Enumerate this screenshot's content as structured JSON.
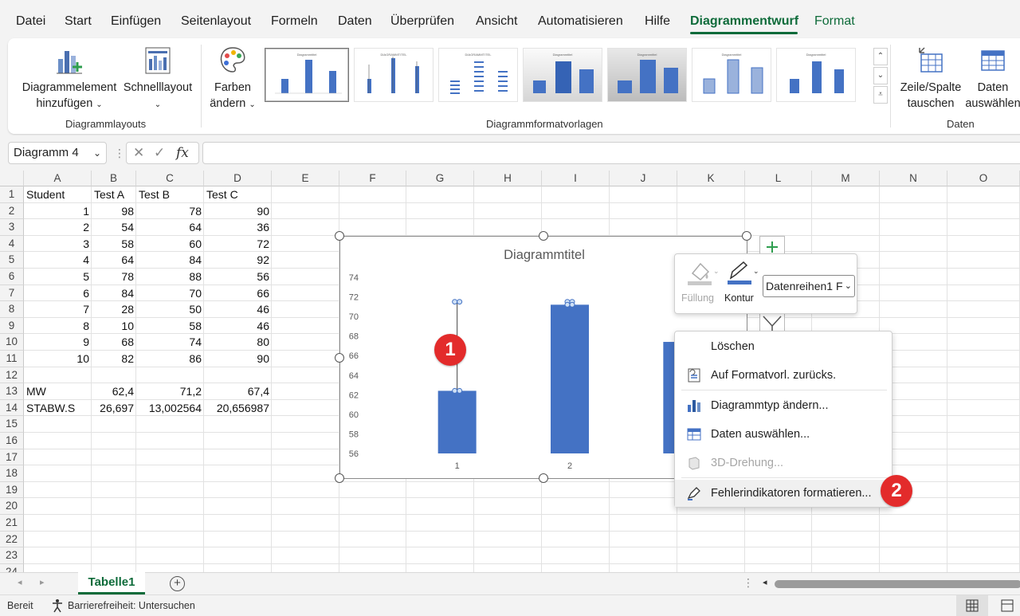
{
  "menu": {
    "tabs": [
      "Datei",
      "Start",
      "Einfügen",
      "Seitenlayout",
      "Formeln",
      "Daten",
      "Überprüfen",
      "Ansicht",
      "Automatisieren",
      "Hilfe",
      "Diagrammentwurf",
      "Format"
    ],
    "active": "Diagrammentwurf"
  },
  "ribbon": {
    "add_element": "Diagrammelement hinzufügen",
    "quick_layout": "Schnelllayout",
    "colors": "Farben ändern",
    "group_layouts": "Diagrammlayouts",
    "group_styles": "Diagrammformatvorlagen",
    "switch_row_col": "Zeile/Spalte tauschen",
    "select_data": "Daten auswählen",
    "group_data": "Daten",
    "thumb_titles": [
      "Diagrammtitel",
      "DIAGRAMMTITEL",
      "DIAGRAMMTITEL",
      "Diagrammtitel",
      "Diagrammtitel",
      "Diagrammtitel",
      "Diagrammtitel"
    ]
  },
  "formula_bar": {
    "name_box": "Diagramm 4",
    "fx": "fx"
  },
  "grid": {
    "columns": [
      "A",
      "B",
      "C",
      "D",
      "E",
      "F",
      "G",
      "H",
      "I",
      "J",
      "K",
      "L",
      "M",
      "N",
      "O"
    ],
    "rows": [
      "1",
      "2",
      "3",
      "4",
      "5",
      "6",
      "7",
      "8",
      "9",
      "10",
      "11",
      "12",
      "13",
      "14",
      "15",
      "16",
      "17",
      "18",
      "19",
      "20",
      "21",
      "22",
      "23",
      "24"
    ],
    "cells": [
      [
        "Student",
        "Test A",
        "Test B",
        "Test C"
      ],
      [
        "1",
        "98",
        "78",
        "90"
      ],
      [
        "2",
        "54",
        "64",
        "36"
      ],
      [
        "3",
        "58",
        "60",
        "72"
      ],
      [
        "4",
        "64",
        "84",
        "92"
      ],
      [
        "5",
        "78",
        "88",
        "56"
      ],
      [
        "6",
        "84",
        "70",
        "66"
      ],
      [
        "7",
        "28",
        "50",
        "46"
      ],
      [
        "8",
        "10",
        "58",
        "46"
      ],
      [
        "9",
        "68",
        "74",
        "80"
      ],
      [
        "10",
        "82",
        "86",
        "90"
      ],
      [
        "",
        "",
        "",
        ""
      ],
      [
        "MW",
        "62,4",
        "71,2",
        "67,4"
      ],
      [
        "STABW.S",
        "26,697",
        "13,002564",
        "20,656987"
      ]
    ]
  },
  "chart": {
    "title": "Diagrammtitel",
    "y_ticks": [
      "74",
      "72",
      "70",
      "68",
      "66",
      "64",
      "62",
      "60",
      "58",
      "56"
    ],
    "x_labels": [
      "1",
      "2",
      "3"
    ],
    "bar_color": "#4472c4"
  },
  "chart_data": {
    "type": "bar",
    "title": "Diagrammtitel",
    "categories": [
      "1",
      "2",
      "3"
    ],
    "values": [
      62.4,
      71.2,
      67.4
    ],
    "error_bar_top": 71.5,
    "ylim": [
      56,
      74
    ],
    "y_step": 2
  },
  "badges": [
    "1",
    "2"
  ],
  "mini_toolbar": {
    "fill": "Füllung",
    "outline": "Kontur",
    "series_select": "Datenreihen1 F"
  },
  "context_menu": {
    "items": [
      {
        "label": "Löschen",
        "disabled": false
      },
      {
        "label": "Auf Formatvorl. zurücks.",
        "disabled": false
      },
      {
        "label": "Diagrammtyp ändern...",
        "disabled": false
      },
      {
        "label": "Daten auswählen...",
        "disabled": false
      },
      {
        "label": "3D-Drehung...",
        "disabled": true
      },
      {
        "label": "Fehlerindikatoren formatieren...",
        "disabled": false
      }
    ]
  },
  "sheet_tabs": {
    "active": "Tabelle1"
  },
  "status": {
    "ready": "Bereit",
    "accessibility": "Barrierefreiheit: Untersuchen"
  }
}
